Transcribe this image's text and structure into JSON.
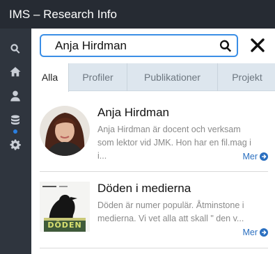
{
  "app": {
    "title": "IMS – Research Info"
  },
  "sidebar": {
    "items": [
      {
        "icon": "search-icon"
      },
      {
        "icon": "home-icon"
      },
      {
        "icon": "user-icon"
      },
      {
        "icon": "database-icon",
        "active": true
      },
      {
        "icon": "gear-icon"
      }
    ]
  },
  "search": {
    "value": "Anja Hirdman",
    "placeholder": ""
  },
  "tabs": [
    {
      "label": "Alla",
      "active": true
    },
    {
      "label": "Profiler"
    },
    {
      "label": "Publikationer"
    },
    {
      "label": "Projekt"
    }
  ],
  "results": [
    {
      "title": "Anja Hirdman",
      "desc_line1": "Anja Hirdman är docent och verksam",
      "desc_line2": "som lektor vid JMK. Hon har en fil.mag i",
      "desc_line3": "i...",
      "more": "Mer"
    },
    {
      "title": "Döden i medierna",
      "desc_line1": "Döden är numer populär. Åtminstone i",
      "desc_line2": "medierna. Vi vet alla att skall \" den v...",
      "more": "Mer",
      "thumb_text": "DÖDEN"
    }
  ],
  "colors": {
    "accent": "#2a7fe0",
    "titlebar": "#262b33",
    "sidebar": "#2f353e"
  }
}
